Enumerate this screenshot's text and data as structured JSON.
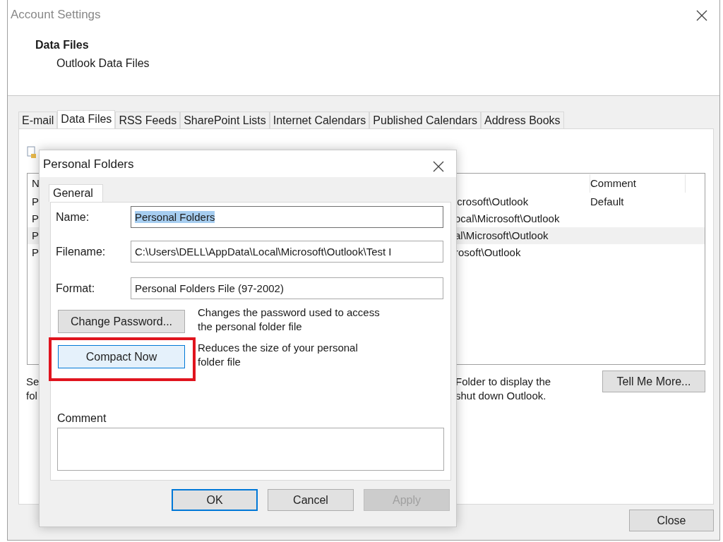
{
  "window": {
    "title": "Account Settings"
  },
  "header": {
    "title": "Data Files",
    "subtitle": "Outlook Data Files"
  },
  "tabs": [
    {
      "label": "E-mail",
      "selected": false
    },
    {
      "label": "Data Files",
      "selected": true
    },
    {
      "label": "RSS Feeds",
      "selected": false
    },
    {
      "label": "SharePoint Lists",
      "selected": false
    },
    {
      "label": "Internet Calendars",
      "selected": false
    },
    {
      "label": "Published Calendars",
      "selected": false
    },
    {
      "label": "Address Books",
      "selected": false
    }
  ],
  "data_files_list": {
    "header": {
      "column_1": "N",
      "column_3": "Comment"
    },
    "rows": [
      {
        "column_1": "P",
        "column_2": "icrosoft\\Outlook",
        "column_3": "Default",
        "selected": false
      },
      {
        "column_1": "P",
        "column_2": "ocal\\Microsoft\\Outlook",
        "selected": false
      },
      {
        "column_1": "P",
        "column_2": "al\\Microsoft\\Outlook",
        "selected": true
      },
      {
        "column_1": "P",
        "column_2": "rosoft\\Outlook",
        "selected": false
      }
    ]
  },
  "info_text": {
    "left_lines": [
      "Se",
      "fol"
    ],
    "right_lines": [
      "Folder to display the",
      "shut down Outlook."
    ]
  },
  "tell_me_more_button": "Tell Me More...",
  "close_button": "Close",
  "dialog": {
    "title": "Personal Folders",
    "tabs": [
      {
        "label": "General",
        "selected": true
      }
    ],
    "fields": [
      {
        "label": "Name:",
        "value": "Personal Folders",
        "text_selected": true
      },
      {
        "label": "Filename:",
        "value": "C:\\Users\\DELL\\AppData\\Local\\Microsoft\\Outlook\\Test I",
        "text_selected": false
      },
      {
        "label": "Format:",
        "value": "Personal Folders File (97-2002)",
        "text_selected": false
      }
    ],
    "actions": [
      {
        "button": "Change Password...",
        "description": "Changes the password used to access the personal folder file",
        "focused": false,
        "highlighted": false
      },
      {
        "button": "Compact Now",
        "description": "Reduces the size of your personal folder file",
        "focused": true,
        "highlighted": true
      }
    ],
    "comment": {
      "label": "Comment"
    },
    "buttons": [
      {
        "label": "OK",
        "default": true,
        "disabled": false
      },
      {
        "label": "Cancel",
        "default": false,
        "disabled": false
      },
      {
        "label": "Apply",
        "default": false,
        "disabled": true
      }
    ]
  }
}
